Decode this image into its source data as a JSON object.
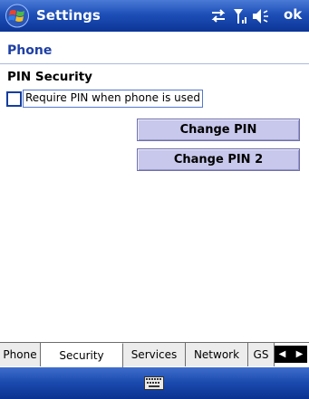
{
  "titlebar": {
    "title": "Settings",
    "ok_label": "ok",
    "icons": [
      "start-flag-icon",
      "sync-icon",
      "signal-icon",
      "speaker-icon"
    ]
  },
  "page": {
    "title": "Phone"
  },
  "security": {
    "section_title": "PIN Security",
    "require_pin_label": "Require PIN when phone is used",
    "require_pin_checked": false,
    "change_pin_label": "Change PIN",
    "change_pin2_label": "Change PIN 2"
  },
  "tabs": [
    {
      "label": "Phone",
      "active": false
    },
    {
      "label": "Security",
      "active": true
    },
    {
      "label": "Services",
      "active": false
    },
    {
      "label": "Network",
      "active": false
    },
    {
      "label": "GS",
      "active": false
    }
  ],
  "bottombar": {
    "icon": "keyboard-icon"
  },
  "colors": {
    "titlebar": "#1d4fb8",
    "page_title": "#1f3fa6",
    "button": "#c8c8ec"
  }
}
